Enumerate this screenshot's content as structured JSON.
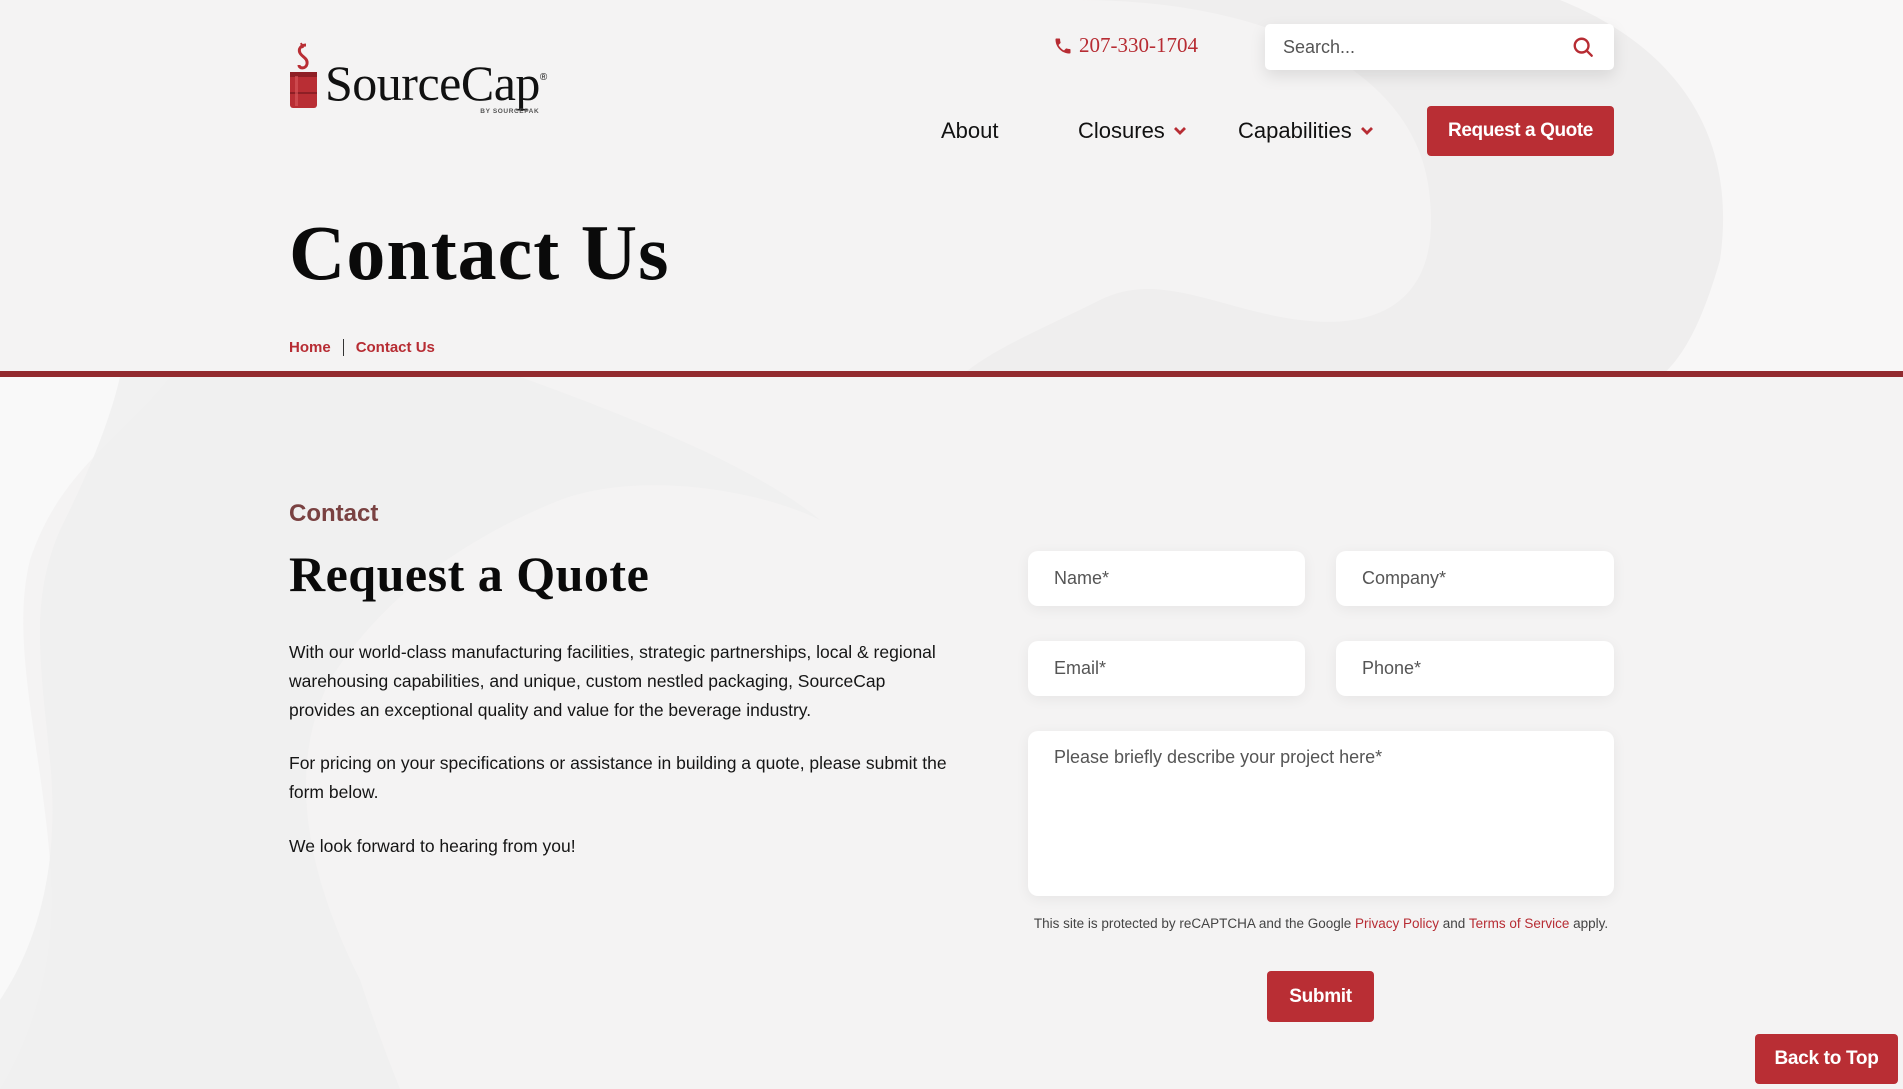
{
  "brand": {
    "name": "SourceCap",
    "registered_mark": "®",
    "tagline": "BY SOURCEPAK",
    "accent_color": "#b92e34",
    "divider_color": "#922a2e"
  },
  "header": {
    "phone": "207-330-1704",
    "search": {
      "placeholder": "Search...",
      "value": ""
    },
    "nav": [
      {
        "label": "About",
        "has_dropdown": false
      },
      {
        "label": "Closures",
        "has_dropdown": true
      },
      {
        "label": "Capabilities",
        "has_dropdown": true
      }
    ],
    "cta_label": "Request a Quote"
  },
  "hero": {
    "title": "Contact Us",
    "breadcrumb": [
      "Home",
      "Contact Us"
    ]
  },
  "content": {
    "eyebrow": "Contact",
    "title": "Request a Quote",
    "paragraphs": [
      "With our world-class manufacturing facilities, strategic partnerships, local & regional warehousing capabilities, and unique, custom nestled packaging, SourceCap provides an exceptional quality and value for the beverage industry.",
      "For pricing on your specifications or assistance in building a quote, please submit the form below.",
      "We look forward to hearing from you!"
    ]
  },
  "form": {
    "name_placeholder": "Name*",
    "company_placeholder": "Company*",
    "email_placeholder": "Email*",
    "phone_placeholder": "Phone*",
    "message_placeholder": "Please briefly describe your project here*",
    "recaptcha": {
      "prefix": "This site is protected by reCAPTCHA and the Google ",
      "privacy_link": "Privacy Policy",
      "middle": " and ",
      "terms_link": "Terms of Service",
      "suffix": " apply."
    },
    "submit_label": "Submit"
  },
  "back_to_top_label": "Back to Top"
}
